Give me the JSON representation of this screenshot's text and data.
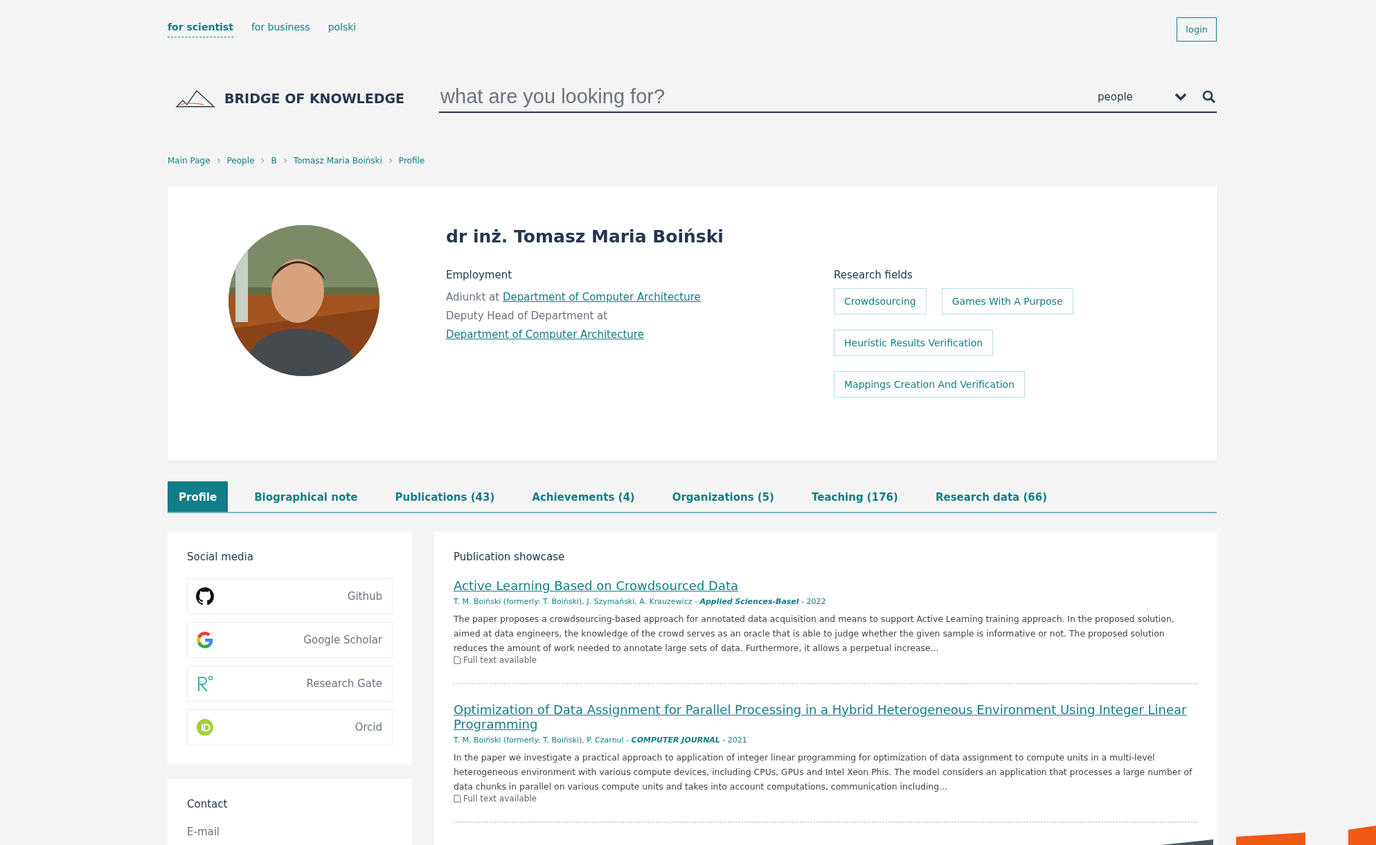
{
  "top_nav": {
    "links": [
      {
        "label": "for scientist",
        "selected": true
      },
      {
        "label": "for business",
        "selected": false
      },
      {
        "label": "polski",
        "selected": false
      }
    ],
    "login": "login"
  },
  "header": {
    "logo": "BRIDGE OF KNOWLEDGE",
    "search": {
      "placeholder": "what are you looking for?",
      "scope": "people"
    }
  },
  "breadcrumb": [
    "Main Page",
    "People",
    "B",
    "Tomasz Maria Boiński",
    "Profile"
  ],
  "profile": {
    "name": "dr inż. Tomasz Maria Boiński",
    "employment": {
      "title": "Employment",
      "entries": [
        {
          "role": "Adiunkt at",
          "unit": "Department of Computer Architecture"
        },
        {
          "role": "Deputy Head of Department at",
          "unit": "Department of Computer Architecture"
        }
      ]
    },
    "research_fields": {
      "title": "Research fields",
      "tags": [
        "Crowdsourcing",
        "Games With A Purpose",
        "Heuristic Results Verification",
        "Mappings Creation And Verification"
      ]
    }
  },
  "tabs": [
    {
      "label": "Profile",
      "selected": true
    },
    {
      "label": "Biographical note",
      "selected": false
    },
    {
      "label": "Publications (43)",
      "selected": false
    },
    {
      "label": "Achievements (4)",
      "selected": false
    },
    {
      "label": "Organizations (5)",
      "selected": false
    },
    {
      "label": "Teaching (176)",
      "selected": false
    },
    {
      "label": "Research data (66)",
      "selected": false
    }
  ],
  "social_media": {
    "title": "Social media",
    "items": [
      {
        "kind": "github",
        "label": "Github"
      },
      {
        "kind": "google",
        "label": "Google Scholar"
      },
      {
        "kind": "researchgate",
        "label": "Research Gate"
      },
      {
        "kind": "orcid",
        "label": "Orcid"
      }
    ]
  },
  "contact": {
    "title": "Contact",
    "fields": [
      "E-mail"
    ]
  },
  "publications": {
    "title": "Publication showcase",
    "items": [
      {
        "title": "Active Learning Based on Crowdsourced Data",
        "byline": "T. M. Boiński (formerly: T. Boiński), J. Szymański, A. Krauzewicz - *Applied Sciences-Basel* - 2022",
        "abstract": "The paper proposes a crowdsourcing-based approach for annotated data acquisition and means to support Active Learning training approach. In the proposed solution, aimed at data engineers, the knowledge of the crowd serves as an oracle that is able to judge whether the given sample is informative or not. The proposed solution reduces the amount of work needed to annotate large sets of data. Furthermore, it allows a perpetual increase...",
        "full_text": "Full text available"
      },
      {
        "title": "Optimization of Data Assignment for Parallel Processing in a Hybrid Heterogeneous Environment Using Integer Linear Programming",
        "byline": "T. M. Boiński (formerly: T. Boiński), P. Czarnul - *COMPUTER JOURNAL* - 2021",
        "abstract": "In the paper we investigate a practical approach to application of integer linear programming for optimization of data assignment to compute units in a multi-level heterogeneous environment with various compute devices, including CPUs, GPUs and Intel Xeon Phis. The model considers an application that processes a large number of data chunks in parallel on various compute units and takes into account computations, communication including...",
        "full_text": "Full text available"
      }
    ]
  }
}
